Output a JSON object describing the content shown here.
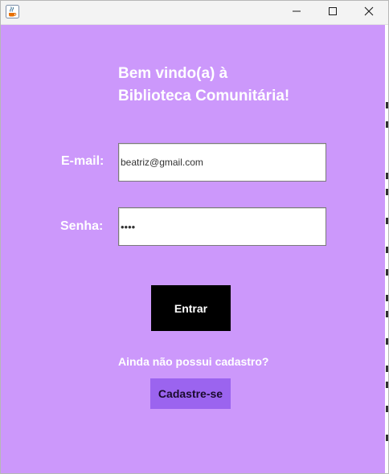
{
  "window": {
    "background_color": "#cc98fb",
    "icons": {
      "app": "java-cup-icon",
      "minimize": "minimize-icon",
      "maximize": "maximize-icon",
      "close": "close-icon"
    }
  },
  "welcome": {
    "line1": "Bem vindo(a) à",
    "line2": "Biblioteca Comunitária!"
  },
  "form": {
    "email_label": "E-mail:",
    "email_value": "beatriz@gmail.com",
    "password_label": "Senha:",
    "password_value": "••••"
  },
  "actions": {
    "login_label": "Entrar",
    "login_color": "#000000",
    "signup_prompt": "Ainda não possui cadastro?",
    "signup_label": "Cadastre-se",
    "signup_color": "#9b64ef"
  }
}
